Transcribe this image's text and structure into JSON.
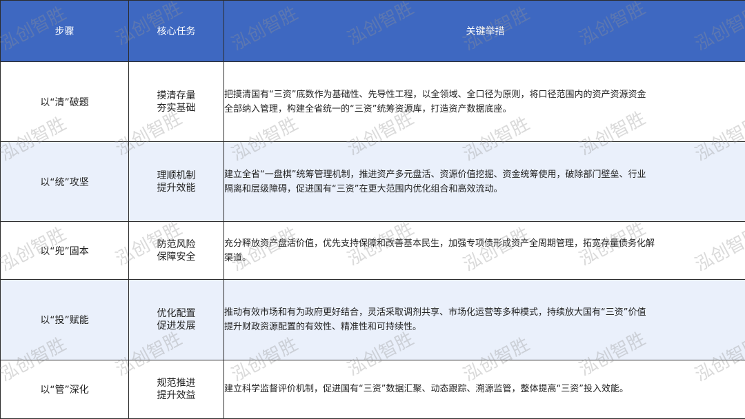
{
  "table": {
    "headers": [
      "步骤",
      "核心任务",
      "关键举措"
    ],
    "rows": [
      {
        "step": "以“清”破题",
        "task": [
          "摸清存量",
          "夯实基础"
        ],
        "measures": [
          "把摸清国有“三资”底数作为基础性、先导性工程，以全领域、全口径为原则，将口径范围内的资产资源资金",
          "全部纳入管理，构建全省统一的“三资”统筹资源库，打造资产数据底座。"
        ]
      },
      {
        "step": "以“统”攻坚",
        "task": [
          "理顺机制",
          "提升效能"
        ],
        "measures": [
          "建立全省“一盘棋”统筹管理机制，推进资产多元盘活、资源价值挖掘、资金统筹使用，破除部门壁垒、行业",
          "隔离和层级障碍，促进国有“三资”在更大范围内优化组合和高效流动。"
        ]
      },
      {
        "step": "以“兜”固本",
        "task": [
          "防范风险",
          "保障安全"
        ],
        "measures": [
          "充分释放资产盘活价值，优先支持保障和改善基本民生，加强专项债形成资产全周期管理，拓宽存量债务化解",
          "渠道。"
        ]
      },
      {
        "step": "以“投”赋能",
        "task": [
          "优化配置",
          "促进发展"
        ],
        "measures": [
          "推动有效市场和有为政府更好结合，灵活采取调剂共享、市场化运营等多种模式，持续放大国有“三资”价值",
          "提升财政资源配置的有效性、精准性和可持续性。"
        ]
      },
      {
        "step": "以“管”深化",
        "task": [
          "规范推进",
          "提升效益"
        ],
        "measures": [
          "建立科学监督评价机制，促进国有“三资”数据汇聚、动态跟踪、溯源监管，整体提高“三资”投入效能。"
        ]
      }
    ]
  },
  "watermark": "泓创智胜",
  "colors": {
    "header_bg": "#3e68c1",
    "header_text": "#ffffff",
    "row_shade": "#eaf0fb",
    "border": "#2b2b2b"
  }
}
